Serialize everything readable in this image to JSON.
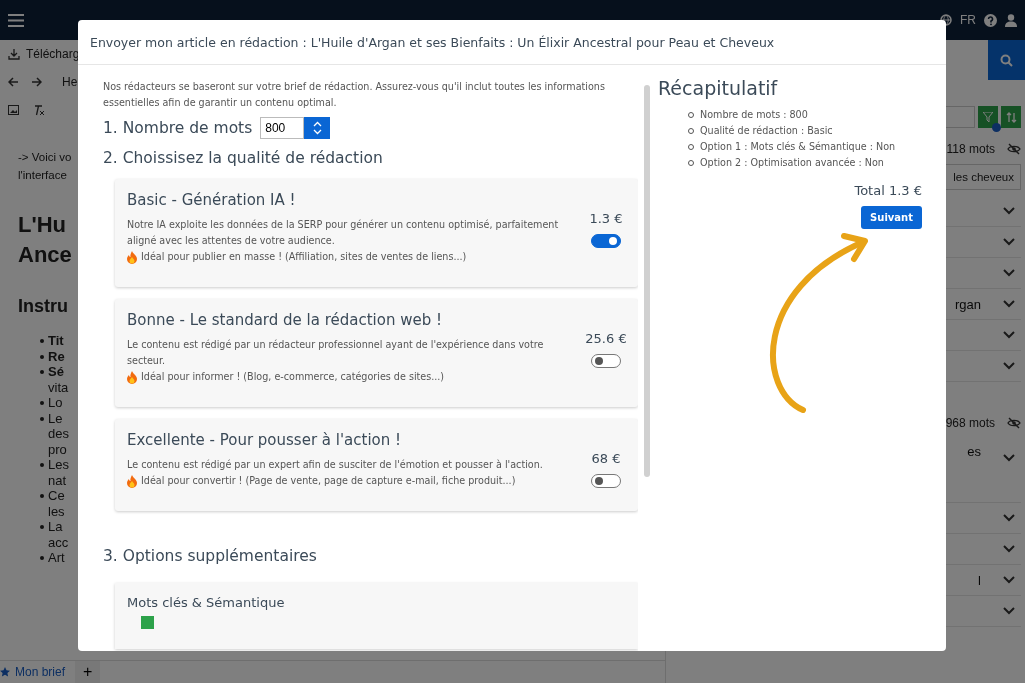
{
  "app_bar": {
    "language": "FR"
  },
  "editor": {
    "download_label": "Télécharg",
    "heading_label": "He",
    "intro_lines": [
      "-> Voici vo",
      "l'interface"
    ],
    "heading_lines": [
      "L'Hu",
      "Ance"
    ],
    "subheading": "Instru",
    "bullets": [
      {
        "lines": [
          "Tit"
        ],
        "bold": true
      },
      {
        "lines": [
          "Re"
        ],
        "bold": true
      },
      {
        "lines": [
          "Sé",
          "vita"
        ],
        "bold": true
      },
      {
        "lines": [
          "Lo"
        ],
        "bold": false
      },
      {
        "lines": [
          "Le",
          "des",
          "pro"
        ],
        "bold": false
      },
      {
        "lines": [
          "Les",
          "nat"
        ],
        "bold": false
      },
      {
        "lines": [
          "Ce",
          "les"
        ],
        "bold": false
      },
      {
        "lines": [
          "La",
          "acc"
        ],
        "bold": false
      },
      {
        "lines": [
          "Art"
        ],
        "bold": false
      }
    ]
  },
  "bottom_tabs": {
    "tabs": [
      {
        "label": "Mon brief",
        "selected": true
      }
    ],
    "add_label": "+"
  },
  "sidebar": {
    "sections": [
      {
        "count": "118 mots",
        "field": "les cheveux",
        "selects": [
          {
            "kind": "blank"
          },
          {
            "kind": "blank"
          },
          {
            "kind": "blank"
          },
          {
            "kind": "text",
            "value": "rgan"
          },
          {
            "kind": "blank"
          },
          {
            "kind": "blank"
          }
        ]
      },
      {
        "count": "968 mots",
        "selects": [
          {
            "kind": "tall",
            "value": "es"
          },
          {
            "kind": "blank"
          },
          {
            "kind": "blank"
          },
          {
            "kind": "text",
            "value": "l"
          },
          {
            "kind": "blank"
          }
        ]
      }
    ]
  },
  "dialog": {
    "title": "Envoyer mon article en rédaction : L'Huile d'Argan et ses Bienfaits : Un Élixir Ancestral pour Peau et Cheveux",
    "intro": "Nos rédacteurs se baseront sur votre brief de rédaction. Assurez-vous qu'il inclut toutes les informations essentielles afin de garantir un contenu optimal.",
    "word_count": {
      "label": "1. Nombre de mots",
      "value": "800"
    },
    "quality": {
      "heading": "2. Choissisez la qualité de rédaction",
      "options": [
        {
          "title": "Basic - Génération IA !",
          "description": "Notre IA exploite les données de la SERP pour générer un contenu optimisé, parfaitement aligné avec les attentes de votre audience.",
          "ideal": "Idéal pour publier en masse ! (Affiliation, sites de ventes de liens...)",
          "price": "1.3 €",
          "selected": true
        },
        {
          "title": "Bonne - Le standard de la rédaction web !",
          "description": "Le contenu est rédigé par un rédacteur professionnel ayant de l'expérience dans votre secteur.",
          "ideal": "Idéal pour informer ! (Blog, e-commerce, catégories de sites...)",
          "price": "25.6 €",
          "selected": false
        },
        {
          "title": "Excellente - Pour pousser à l'action !",
          "description": "Le contenu est rédigé par un expert afin de susciter de l'émotion et pousser à l'action.",
          "ideal": "Idéal pour convertir ! (Page de vente, page de capture e-mail, fiche produit...)",
          "price": "68 €",
          "selected": false
        }
      ]
    },
    "extras": {
      "heading": "3. Options supplémentaires",
      "options": [
        {
          "title": "Mots clés & Sémantique",
          "checked": true
        }
      ]
    },
    "summary": {
      "title": "Récapitulatif",
      "items": [
        "Nombre de mots : 800",
        "Qualité de rédaction : Basic",
        "Option 1 : Mots clés & Sémantique : Non",
        "Option 2 : Optimisation avancée : Non"
      ],
      "total": "Total 1.3 €",
      "button": "Suivant"
    }
  }
}
